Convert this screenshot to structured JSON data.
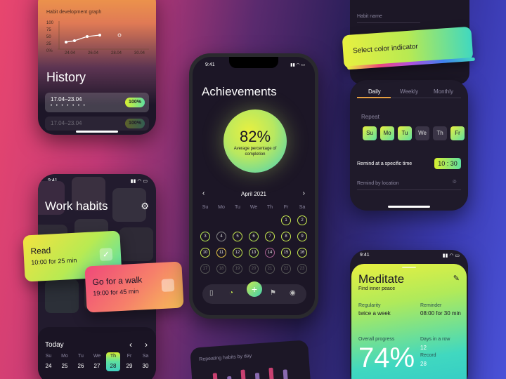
{
  "history_screen": {
    "graph_title": "Habit development graph",
    "y_ticks": [
      "100",
      "75",
      "50",
      "25",
      "0%"
    ],
    "x_ticks": [
      "24.04",
      "26.04",
      "28.04",
      "30.04"
    ],
    "title": "History",
    "card1": {
      "date": "17.04–23.04",
      "dots": "• • • • • • •",
      "badge": "100%"
    },
    "card2": {
      "date": "17.04–23.04",
      "badge": "100%"
    }
  },
  "work_screen": {
    "time": "9:41",
    "title": "Work habits",
    "cards": [
      {
        "title": "Read",
        "sub": "10:00 for 25 min"
      },
      {
        "title": "Go for a walk",
        "sub": "19:00 for 45 min"
      }
    ],
    "today": "Today",
    "weekdays": [
      "Su",
      "Mo",
      "Tu",
      "We",
      "Th",
      "Fr",
      "Sa"
    ],
    "dates": [
      "24",
      "25",
      "26",
      "27",
      "28",
      "29",
      "30"
    ],
    "selected_index": 4
  },
  "achievements_screen": {
    "time": "9:41",
    "title": "Achievements",
    "percentage": "82%",
    "percentage_label": "Average percentage of completion",
    "month": "April 2021",
    "weekdays": [
      "Su",
      "Mo",
      "Tu",
      "We",
      "Th",
      "Fr",
      "Sa"
    ],
    "rows": [
      [
        "",
        "",
        "",
        "",
        "",
        "1",
        "2"
      ],
      [
        "3",
        "4",
        "5",
        "6",
        "7",
        "8",
        "9"
      ],
      [
        "10",
        "11",
        "12",
        "13",
        "14",
        "15",
        "16"
      ],
      [
        "17",
        "18",
        "19",
        "20",
        "21",
        "22",
        "23"
      ]
    ]
  },
  "settings_screen": {
    "habit_name_label": "Habit name",
    "color_title": "Select color indicator",
    "tabs": [
      "Daily",
      "Weekly",
      "Monthly"
    ],
    "repeat_label": "Repeat",
    "days": [
      "Su",
      "Mo",
      "Tu",
      "We",
      "Th",
      "Fr",
      "Sa"
    ],
    "active_days": [
      true,
      true,
      true,
      false,
      false,
      true,
      false
    ],
    "remind_label": "Remind at a specific time",
    "remind_time": "10 : 30",
    "location_label": "Remind by location"
  },
  "meditate_screen": {
    "time": "9:41",
    "title": "Meditate",
    "subtitle": "Find inner peace",
    "regularity_label": "Regularity",
    "regularity_value": "twice a week",
    "reminder_label": "Reminder",
    "reminder_value": "08:00 for 30 min",
    "progress_label": "Overall progress",
    "progress_value": "74%",
    "days_row_label": "Days in a row",
    "days_row_value": "12",
    "record_label": "Record",
    "record_value": "28"
  },
  "bars_panel": {
    "title": "Repeating habits by day"
  }
}
